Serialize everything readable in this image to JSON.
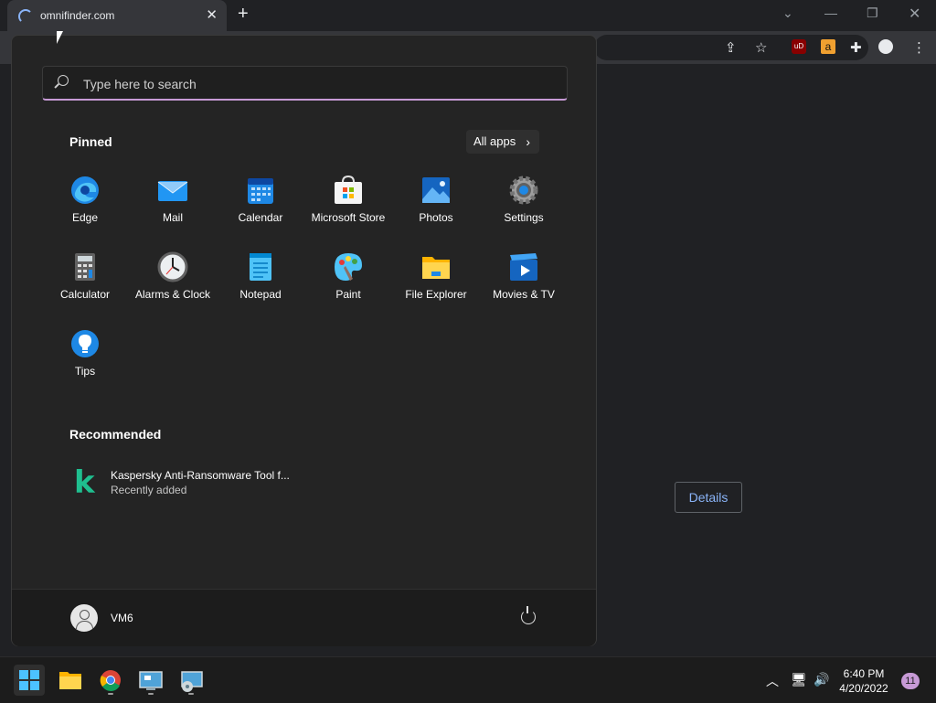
{
  "browser": {
    "tab_title": "omnifinder.com",
    "tab_close": "✕",
    "new_tab": "+",
    "page_button": "Details"
  },
  "start_menu": {
    "search_placeholder": "Type here to search",
    "pinned_title": "Pinned",
    "all_apps_label": "All apps",
    "pinned_apps": [
      {
        "label": "Edge",
        "icon": "edge-icon"
      },
      {
        "label": "Mail",
        "icon": "mail-icon"
      },
      {
        "label": "Calendar",
        "icon": "calendar-icon"
      },
      {
        "label": "Microsoft Store",
        "icon": "store-icon"
      },
      {
        "label": "Photos",
        "icon": "photos-icon"
      },
      {
        "label": "Settings",
        "icon": "settings-icon"
      },
      {
        "label": "Calculator",
        "icon": "calculator-icon"
      },
      {
        "label": "Alarms & Clock",
        "icon": "clock-icon"
      },
      {
        "label": "Notepad",
        "icon": "notepad-icon"
      },
      {
        "label": "Paint",
        "icon": "paint-icon"
      },
      {
        "label": "File Explorer",
        "icon": "folder-icon"
      },
      {
        "label": "Movies & TV",
        "icon": "movies-icon"
      },
      {
        "label": "Tips",
        "icon": "tips-icon"
      }
    ],
    "recommended_title": "Recommended",
    "recommended": [
      {
        "title": "Kaspersky Anti-Ransomware Tool f...",
        "subtitle": "Recently added",
        "icon": "kaspersky-icon"
      }
    ],
    "user_name": "VM6"
  },
  "taskbar": {
    "apps": [
      "start-icon",
      "file-explorer-icon",
      "chrome-icon",
      "control-panel-icon",
      "installer-icon"
    ],
    "time": "6:40 PM",
    "date": "4/20/2022",
    "notification_count": "11"
  }
}
